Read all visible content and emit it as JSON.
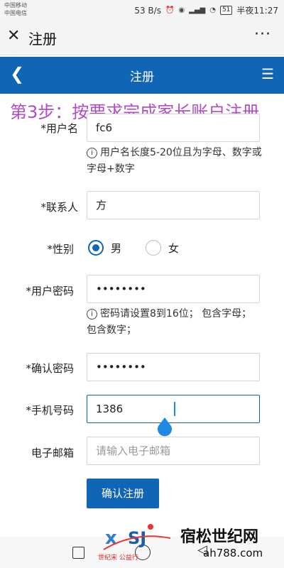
{
  "status_bar": {
    "carrier1": "中国移动",
    "carrier2": "中国电信",
    "speed": "53 B/s",
    "battery": "51",
    "time": "半夜11:27"
  },
  "title_bar": {
    "title": "注册"
  },
  "app_header": {
    "title": "注册"
  },
  "banner": "第3步：按要求完成家长账户注册",
  "form": {
    "username": {
      "label": "*用户名",
      "value": "fc6"
    },
    "username_hint": "用户名长度5-20位且为字母、数字或字母+数字",
    "contact": {
      "label": "*联系人",
      "value": "方"
    },
    "gender": {
      "label": "*性别",
      "options": [
        "男",
        "女"
      ],
      "selected": "男"
    },
    "password": {
      "label": "*用户密码",
      "value": "••••••••"
    },
    "password_hint": "密码请设置8到16位； 包含字母； 包含数字；",
    "confirm": {
      "label": "*确认密码",
      "value": "••••••••"
    },
    "phone": {
      "label": "*手机号码",
      "value": "1386"
    },
    "email": {
      "label": "电子邮箱",
      "placeholder": "请输入电子邮箱"
    },
    "submit": "确认注册"
  },
  "watermark": {
    "brand": "世纪宋 公益行",
    "title": "宿松世纪网",
    "url": "ah788.com"
  },
  "colors": {
    "primary": "#1165b5",
    "banner": "#b04cc4",
    "required": "#e02020"
  }
}
